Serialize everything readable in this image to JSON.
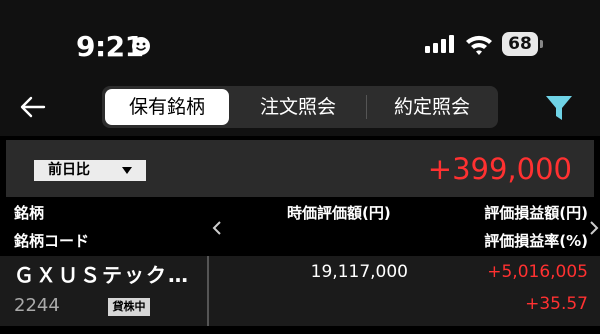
{
  "status_bar": {
    "time": "9:21",
    "battery": "68",
    "icons": [
      "smiley-icon",
      "cellular-icon",
      "wifi-icon",
      "battery-icon"
    ]
  },
  "nav": {
    "back_icon": "back-arrow-icon",
    "tabs": [
      {
        "label": "保有銘柄",
        "active": true
      },
      {
        "label": "注文照会",
        "active": false
      },
      {
        "label": "約定照会",
        "active": false
      }
    ],
    "filter_icon": "filter-icon",
    "accent_color": "#6fd3e6"
  },
  "summary": {
    "dropdown_value": "前日比",
    "total_change": "+399,000"
  },
  "table_header": {
    "col1_line1": "銘柄",
    "col1_line2": "銘柄コード",
    "col2": "時価評価額(円)",
    "col3_line1": "評価損益額(円)",
    "col3_line2": "評価損益率(%)"
  },
  "holdings": [
    {
      "name": "ＧＸＵＳテック…",
      "code": "2244",
      "badge": "貸株中",
      "market_value": "19,117,000",
      "pl_amount": "+5,016,005",
      "pl_rate": "+35.57"
    }
  ],
  "colors": {
    "positive": "#ff3131",
    "background": "#000000"
  }
}
